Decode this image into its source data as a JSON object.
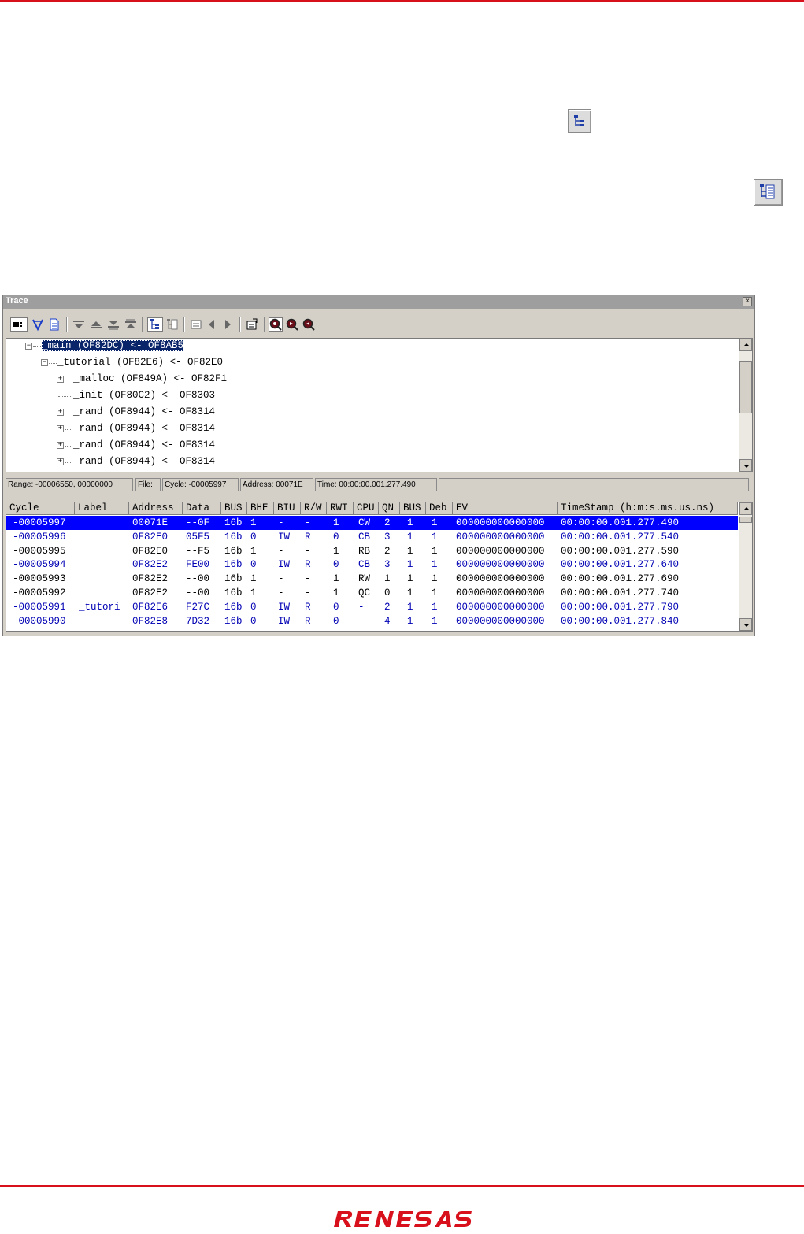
{
  "window": {
    "title": "Trace",
    "close_glyph": "×"
  },
  "colors": {
    "accent_rule": "#d8101c",
    "selection": "#0000ff",
    "tree_selection": "#0a246a",
    "blue_text": "#0000b4"
  },
  "toolbar": {
    "buttons": [
      "display-mode-icon",
      "filter-icon",
      "file-icon",
      "move-down-icon",
      "move-up-icon",
      "move-bottom-icon",
      "move-top-icon",
      "function-tree-icon",
      "source-view-icon",
      "jump-icon",
      "previous-icon",
      "next-icon",
      "properties-icon",
      "search-icon",
      "search-forward-icon",
      "search-backward-icon"
    ]
  },
  "tree": {
    "rows": [
      {
        "text": "_main (OF82DC) <- OF8AB5",
        "expander": "⊟",
        "selected": true
      },
      {
        "text": "_tutorial (OF82E6) <- OF82E0",
        "expander": "⊟",
        "selected": false
      },
      {
        "text": "_malloc (OF849A) <- OF82F1",
        "expander": "⊞",
        "selected": false
      },
      {
        "text": "_init (OF80C2) <- OF8303",
        "expander": "",
        "selected": false
      },
      {
        "text": "_rand (OF8944) <- OF8314",
        "expander": "⊞",
        "selected": false
      },
      {
        "text": "_rand (OF8944) <- OF8314",
        "expander": "⊞",
        "selected": false
      },
      {
        "text": "_rand (OF8944) <- OF8314",
        "expander": "⊞",
        "selected": false
      },
      {
        "text": "_rand (OF8944) <- OF8314",
        "expander": "⊞",
        "selected": false
      }
    ]
  },
  "status": {
    "range": "Range: -00006550, 00000000",
    "file": "File:",
    "cycle": "Cycle: -00005997",
    "address": "Address: 00071E",
    "time": "Time: 00:00:00.001.277.490"
  },
  "grid": {
    "columns": [
      "Cycle",
      "Label",
      "Address",
      "Data",
      "BUS",
      "BHE",
      "BIU",
      "R/W",
      "RWT",
      "CPU",
      "QN",
      "BUS",
      "Deb",
      "EV",
      "TimeStamp (h:m:s.ms.us.ns)"
    ],
    "rows": [
      {
        "style": "sel",
        "cells": [
          "-00005997",
          "",
          "00071E",
          "--0F",
          "16b",
          "1",
          "-",
          "-",
          "1",
          "CW",
          "2",
          "1",
          "1",
          "000000000000000",
          "00:00:00.001.277.490"
        ]
      },
      {
        "style": "blue",
        "cells": [
          "-00005996",
          "",
          "0F82E0",
          "05F5",
          "16b",
          "0",
          "IW",
          "R",
          "0",
          "CB",
          "3",
          "1",
          "1",
          "000000000000000",
          "00:00:00.001.277.540"
        ]
      },
      {
        "style": "black",
        "cells": [
          "-00005995",
          "",
          "0F82E0",
          "--F5",
          "16b",
          "1",
          "-",
          "-",
          "1",
          "RB",
          "2",
          "1",
          "1",
          "000000000000000",
          "00:00:00.001.277.590"
        ]
      },
      {
        "style": "blue",
        "cells": [
          "-00005994",
          "",
          "0F82E2",
          "FE00",
          "16b",
          "0",
          "IW",
          "R",
          "0",
          "CB",
          "3",
          "1",
          "1",
          "000000000000000",
          "00:00:00.001.277.640"
        ]
      },
      {
        "style": "black",
        "cells": [
          "-00005993",
          "",
          "0F82E2",
          "--00",
          "16b",
          "1",
          "-",
          "-",
          "1",
          "RW",
          "1",
          "1",
          "1",
          "000000000000000",
          "00:00:00.001.277.690"
        ]
      },
      {
        "style": "black",
        "cells": [
          "-00005992",
          "",
          "0F82E2",
          "--00",
          "16b",
          "1",
          "-",
          "-",
          "1",
          "QC",
          "0",
          "1",
          "1",
          "000000000000000",
          "00:00:00.001.277.740"
        ]
      },
      {
        "style": "blue",
        "cells": [
          "-00005991",
          "_tutori",
          "0F82E6",
          "F27C",
          "16b",
          "0",
          "IW",
          "R",
          "0",
          "-",
          "2",
          "1",
          "1",
          "000000000000000",
          "00:00:00.001.277.790"
        ]
      },
      {
        "style": "blue",
        "cells": [
          "-00005990",
          "",
          "0F82E8",
          "7D32",
          "16b",
          "0",
          "IW",
          "R",
          "0",
          "-",
          "4",
          "1",
          "1",
          "000000000000000",
          "00:00:00.001.277.840"
        ]
      }
    ]
  },
  "logo": {
    "text": "RENESAS"
  }
}
